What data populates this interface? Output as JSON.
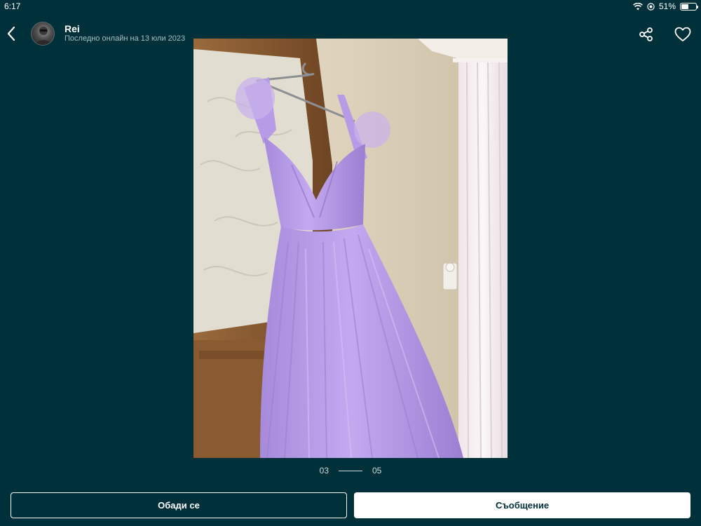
{
  "status_bar": {
    "time": "6:17",
    "battery_text": "51%",
    "battery_level": 0.51,
    "icons": [
      "wifi-icon",
      "location-icon",
      "battery-icon"
    ]
  },
  "header": {
    "back_icon": "chevron-left-icon",
    "user_name": "Rei",
    "last_online": "Последно онлайн на 13 юли 2023",
    "share_icon": "share-icon",
    "favorite_icon": "heart-icon"
  },
  "pager": {
    "current": "03",
    "total": "05"
  },
  "actions": {
    "call_label": "Обади се",
    "message_label": "Съобщение"
  },
  "colors": {
    "background": "#00303a",
    "primary_text": "#ffffff",
    "secondary_text": "#a9bfc3",
    "dress": "#b89be6"
  }
}
